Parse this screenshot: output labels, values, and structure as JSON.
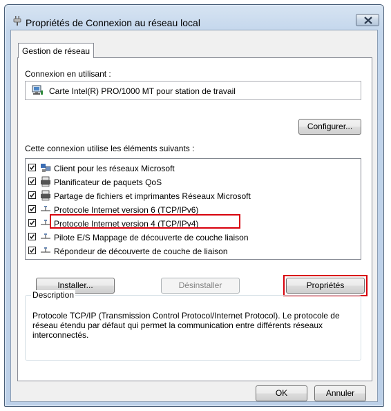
{
  "window": {
    "title": "Propriétés de Connexion au réseau local",
    "close_icon": "close-icon"
  },
  "tabs": [
    {
      "label": "Gestion de réseau"
    }
  ],
  "connect_using": {
    "label": "Connexion en utilisant :",
    "adapter": "Carte Intel(R) PRO/1000 MT pour station de travail",
    "adapter_icon": "network-adapter-icon"
  },
  "configure_label": "Configurer...",
  "items_label": "Cette connexion utilise les éléments suivants :",
  "items": [
    {
      "label": "Client pour les réseaux Microsoft",
      "checked": true,
      "icon": "network-client-icon"
    },
    {
      "label": "Planificateur de paquets QoS",
      "checked": true,
      "icon": "service-printer-icon"
    },
    {
      "label": "Partage de fichiers et imprimantes Réseaux Microsoft",
      "checked": true,
      "icon": "service-printer-icon"
    },
    {
      "label": "Protocole Internet version 6 (TCP/IPv6)",
      "checked": true,
      "icon": "protocol-icon"
    },
    {
      "label": "Protocole Internet version 4 (TCP/IPv4)",
      "checked": true,
      "icon": "protocol-icon",
      "highlighted": true
    },
    {
      "label": "Pilote E/S Mappage de découverte de couche liaison",
      "checked": true,
      "icon": "protocol-icon"
    },
    {
      "label": "Répondeur de découverte de couche de liaison",
      "checked": true,
      "icon": "protocol-icon"
    }
  ],
  "buttons": {
    "install": "Installer...",
    "uninstall": "Désinstaller",
    "properties": "Propriétés",
    "ok": "OK",
    "cancel": "Annuler"
  },
  "description": {
    "title": "Description",
    "text": "Protocole TCP/IP (Transmission Control Protocol/Internet Protocol). Le protocole de réseau étendu par défaut qui permet la communication entre différents réseaux interconnectés."
  },
  "colors": {
    "highlight": "#d8000c",
    "accent": "#c3d6ec"
  }
}
